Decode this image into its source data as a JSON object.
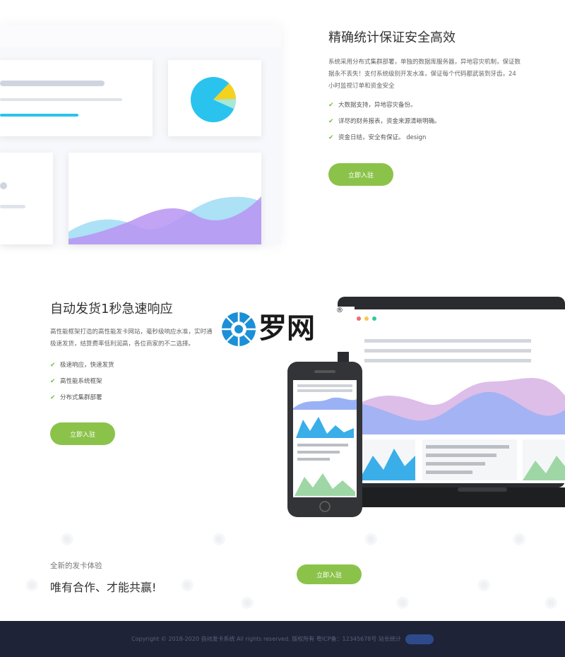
{
  "section1": {
    "title": "精确统计保证安全高效",
    "description": "系统采用分布式集群部署，单独的数据库服务器，异地容灾机制，保证数据永不丢失！支付系统级别开发水准，保证每个代码都武装到牙齿，24小时监视订单和资金安全",
    "features": [
      "大数据支持，异地容灾备份。",
      "详尽的财务报表，资金来源清晰明确。",
      "资金日结，安全有保证。 design"
    ],
    "button_label": "立即入驻"
  },
  "section2": {
    "title": "自动发货1秒急速响应",
    "description": "高性能框架打造的高性能发卡网站，毫秒级响应水准，实时通极速发货，结算费率低利润高，各位商家的不二选择。",
    "features": [
      "极速响应，快速发货",
      "高性能系统框架",
      "分布式集群部署"
    ],
    "button_label": "立即入驻"
  },
  "logo": {
    "text": "罗网",
    "mark": "®"
  },
  "cta": {
    "subtitle": "全新的发卡体验",
    "title": "唯有合作、才能共赢!",
    "button_label": "立即入驻"
  },
  "footer": {
    "copyright": "Copyright © 2018-2020 自动发卡系统 All rights reserved. 版权所有 粤ICP备：12345678号 站长统计"
  },
  "colors": {
    "accent_green": "#8bc34a",
    "footer_bg": "#1e2338",
    "cyan": "#29c3ee",
    "purple": "#b89af0"
  }
}
